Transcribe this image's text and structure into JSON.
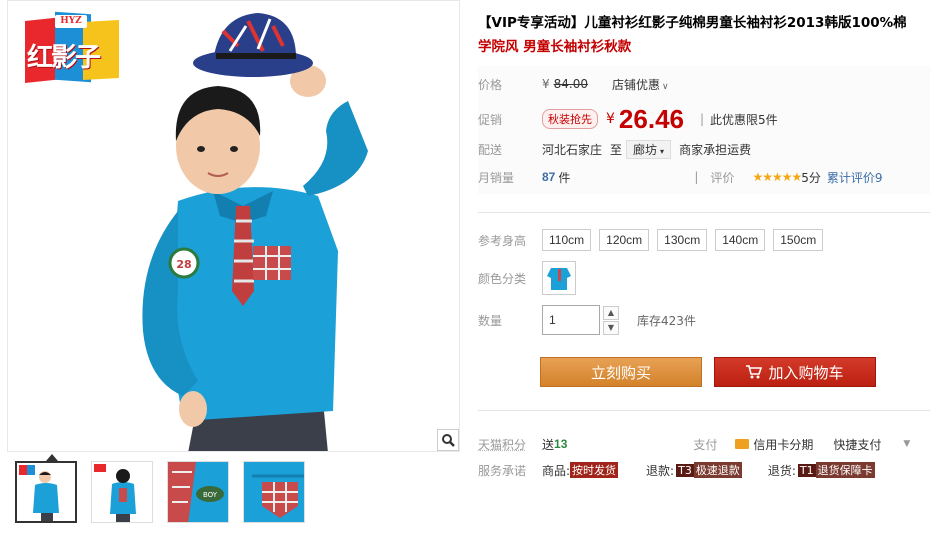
{
  "brand": {
    "badge": "HYZ",
    "name": "红影子",
    "colors": {
      "red": "#e8282d",
      "blue": "#1c8fd6",
      "yellow": "#f6c21c"
    }
  },
  "gallery": {
    "zoom_icon": "magnifier-icon",
    "thumbnails": [
      {
        "label": "thumb-front",
        "active": true
      },
      {
        "label": "thumb-back",
        "active": false
      },
      {
        "label": "thumb-detail-badge",
        "active": false
      },
      {
        "label": "thumb-detail-pocket",
        "active": false
      }
    ]
  },
  "product": {
    "title": "【VIP专享活动】儿童衬衫红影子纯棉男童长袖衬衫2013韩版100%棉",
    "subtitle": "学院风 男童长袖衬衫秋款"
  },
  "meta": {
    "price_label": "价格",
    "original_price_currency": "¥",
    "original_price": "84.00",
    "shop_discount": "店铺优惠",
    "promo_label": "促销",
    "promo_tag": "秋装抢先",
    "promo_currency": "¥",
    "promo_price": "26.46",
    "promo_limit": "此优惠限5件",
    "delivery_label": "配送",
    "origin": "河北石家庄",
    "to": "至",
    "destination": "廊坊",
    "shipping": "商家承担运费",
    "monthly_label": "月销量",
    "monthly_sales": "87",
    "monthly_unit": "件",
    "rating_label": "评价",
    "stars": "★★★★★",
    "score": "5分",
    "review_count_text": "累计评价9"
  },
  "options": {
    "size_label": "参考身高",
    "sizes": [
      "110cm",
      "120cm",
      "130cm",
      "140cm",
      "150cm"
    ],
    "color_label": "颜色分类",
    "qty_label": "数量",
    "qty_value": "1",
    "stock": "库存423件"
  },
  "actions": {
    "buy": "立刻购买",
    "cart": "加入购物车"
  },
  "services": {
    "points_label": "天猫积分",
    "points_prefix": "送",
    "points_value": "13",
    "pay_label": "支付",
    "card_installment": "信用卡分期",
    "quick_pay": "快捷支付",
    "promise_label": "服务承诺",
    "goods_label": "商品:",
    "goods_tag": "按时发货",
    "refund_label": "退款:",
    "refund_badge": "T3",
    "refund_tag": "极速退款",
    "return_label": "退货:",
    "return_badge": "T1",
    "return_tag": "退货保障卡"
  }
}
